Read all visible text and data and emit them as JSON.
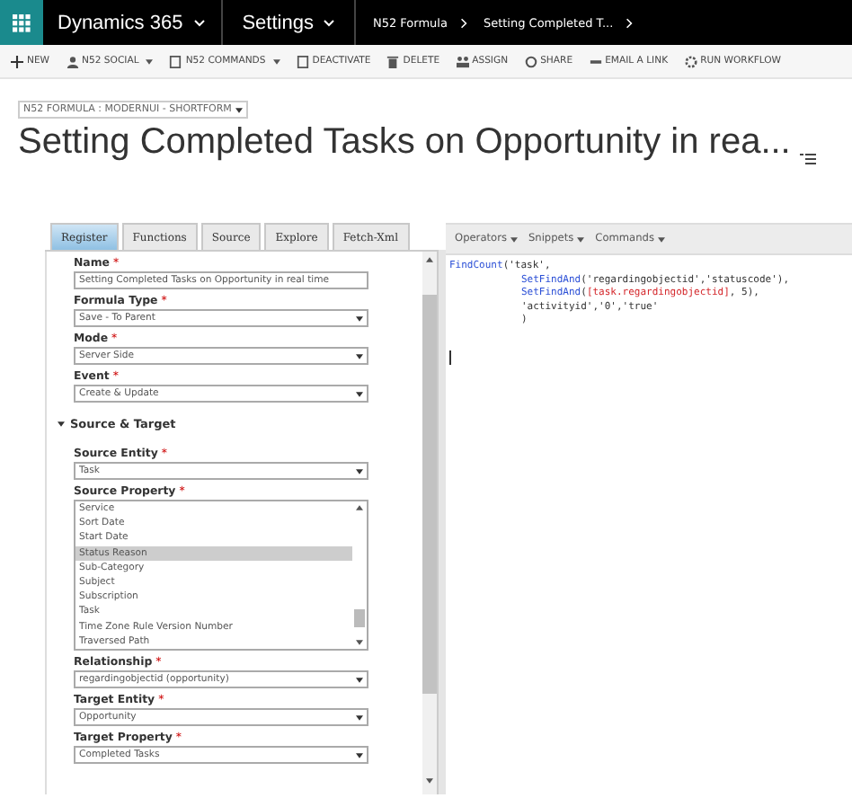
{
  "nav": {
    "app": "Dynamics 365",
    "area": "Settings",
    "breadcrumbs": [
      "N52 Formula",
      "Setting Completed T..."
    ]
  },
  "commands": [
    {
      "label": "NEW",
      "dropdown": false
    },
    {
      "label": "N52 SOCIAL",
      "dropdown": true
    },
    {
      "label": "N52 COMMANDS",
      "dropdown": true
    },
    {
      "label": "DEACTIVATE",
      "dropdown": false
    },
    {
      "label": "DELETE",
      "dropdown": false
    },
    {
      "label": "ASSIGN",
      "dropdown": false
    },
    {
      "label": "SHARE",
      "dropdown": false
    },
    {
      "label": "EMAIL A LINK",
      "dropdown": false
    },
    {
      "label": "RUN WORKFLOW",
      "dropdown": false
    }
  ],
  "form_selector": "N52 FORMULA : MODERNUI - SHORTFORM",
  "title": "Setting Completed Tasks on Opportunity in rea...",
  "tabs": [
    {
      "label": "Register",
      "selected": true
    },
    {
      "label": "Functions",
      "selected": false
    },
    {
      "label": "Source",
      "selected": false
    },
    {
      "label": "Explore",
      "selected": false
    },
    {
      "label": "Fetch-Xml",
      "selected": false
    }
  ],
  "fields": [
    {
      "kind": "text",
      "label": "Name",
      "mark": "*",
      "value": "Setting Completed Tasks on Opportunity in real time"
    },
    {
      "kind": "select",
      "label": "Formula Type",
      "mark": "*",
      "value": "Save - To Parent"
    },
    {
      "kind": "select",
      "label": "Mode",
      "mark": "*",
      "value": "Server Side"
    },
    {
      "kind": "select",
      "label": "Event",
      "mark": "*",
      "value": "Create & Update"
    },
    {
      "kind": "section",
      "label": "Source & Target",
      "expanded": true
    },
    {
      "kind": "select",
      "label": "Source Entity",
      "mark": "*",
      "value": "Task"
    },
    {
      "kind": "list",
      "label": "Source Property",
      "mark": "*",
      "options": [
        {
          "text": "Service",
          "selected": false
        },
        {
          "text": "Sort Date",
          "selected": false
        },
        {
          "text": "Start Date",
          "selected": false
        },
        {
          "text": "Status Reason",
          "selected": true
        },
        {
          "text": "Sub-Category",
          "selected": false
        },
        {
          "text": "Subject",
          "selected": false
        },
        {
          "text": "Subscription",
          "selected": false
        },
        {
          "text": "Task",
          "selected": false
        },
        {
          "text": "Time Zone Rule Version Number",
          "selected": false
        },
        {
          "text": "Traversed Path",
          "selected": false
        }
      ]
    },
    {
      "kind": "select",
      "label": "Relationship",
      "mark": "*",
      "value": "regardingobjectid (opportunity)"
    },
    {
      "kind": "select",
      "label": "Target Entity",
      "mark": "*",
      "value": "Opportunity"
    },
    {
      "kind": "select",
      "label": "Target Property",
      "mark": "*",
      "value": "Completed Tasks"
    }
  ],
  "editor_menus": [
    "Operators",
    "Snippets",
    "Commands"
  ],
  "code": [
    {
      "indented": false,
      "parts": [
        {
          "kind": "fn",
          "text": "FindCount"
        },
        {
          "kind": "plain",
          "text": "('task',"
        }
      ]
    },
    {
      "indented": true,
      "parts": [
        {
          "kind": "fn",
          "text": "SetFindAnd"
        },
        {
          "kind": "plain",
          "text": "('regardingobjectid','statuscode'),"
        }
      ]
    },
    {
      "indented": true,
      "parts": [
        {
          "kind": "fn",
          "text": "SetFindAnd"
        },
        {
          "kind": "plain",
          "text": "("
        },
        {
          "kind": "ref",
          "text": "[task.regardingobjectid]"
        },
        {
          "kind": "plain",
          "text": ", 5),"
        }
      ]
    },
    {
      "indented": true,
      "parts": [
        {
          "kind": "plain",
          "text": "'activityid','0','true'"
        }
      ]
    },
    {
      "indented": true,
      "parts": [
        {
          "kind": "plain",
          "text": ")"
        }
      ]
    }
  ]
}
